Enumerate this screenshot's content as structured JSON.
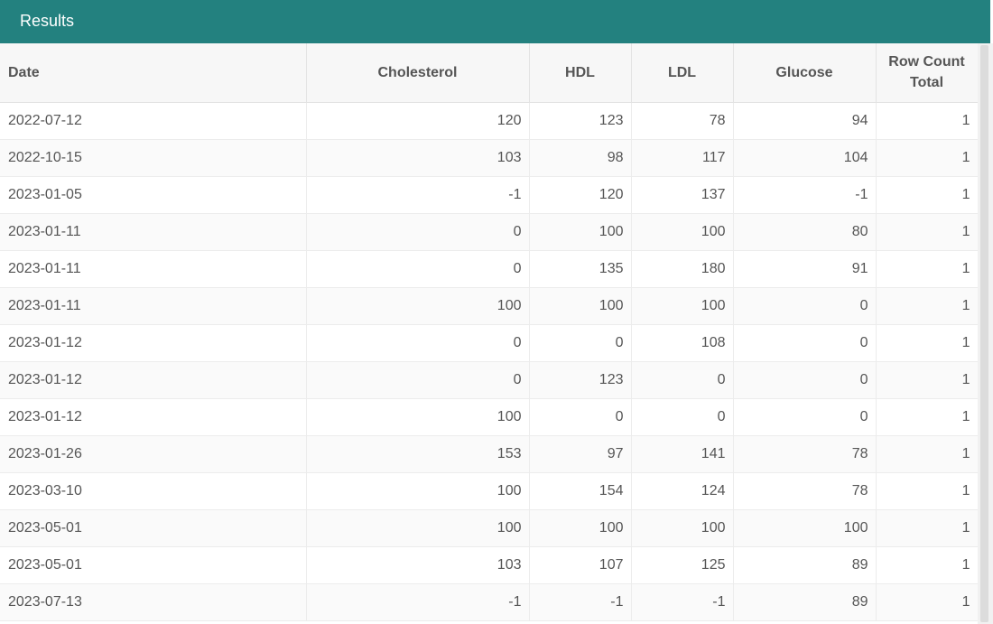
{
  "panel": {
    "title": "Results"
  },
  "columns": [
    {
      "key": "date",
      "lines": [
        "Date"
      ]
    },
    {
      "key": "cholesterol",
      "lines": [
        "Cholesterol"
      ]
    },
    {
      "key": "hdl",
      "lines": [
        "HDL"
      ]
    },
    {
      "key": "ldl",
      "lines": [
        "LDL"
      ]
    },
    {
      "key": "glucose",
      "lines": [
        "Glucose"
      ]
    },
    {
      "key": "rowcount",
      "lines": [
        "Row Count",
        "Total"
      ]
    }
  ],
  "rows": [
    [
      "2022-07-12",
      "120",
      "123",
      "78",
      "94",
      "1"
    ],
    [
      "2022-10-15",
      "103",
      "98",
      "117",
      "104",
      "1"
    ],
    [
      "2023-01-05",
      "-1",
      "120",
      "137",
      "-1",
      "1"
    ],
    [
      "2023-01-11",
      "0",
      "100",
      "100",
      "80",
      "1"
    ],
    [
      "2023-01-11",
      "0",
      "135",
      "180",
      "91",
      "1"
    ],
    [
      "2023-01-11",
      "100",
      "100",
      "100",
      "0",
      "1"
    ],
    [
      "2023-01-12",
      "0",
      "0",
      "108",
      "0",
      "1"
    ],
    [
      "2023-01-12",
      "0",
      "123",
      "0",
      "0",
      "1"
    ],
    [
      "2023-01-12",
      "100",
      "0",
      "0",
      "0",
      "1"
    ],
    [
      "2023-01-26",
      "153",
      "97",
      "141",
      "78",
      "1"
    ],
    [
      "2023-03-10",
      "100",
      "154",
      "124",
      "78",
      "1"
    ],
    [
      "2023-05-01",
      "100",
      "100",
      "100",
      "100",
      "1"
    ],
    [
      "2023-05-01",
      "103",
      "107",
      "125",
      "89",
      "1"
    ],
    [
      "2023-07-13",
      "-1",
      "-1",
      "-1",
      "89",
      "1"
    ]
  ],
  "colors": {
    "header_bg": "#23817f",
    "header_text": "#ffffff",
    "table_text": "#555555"
  }
}
